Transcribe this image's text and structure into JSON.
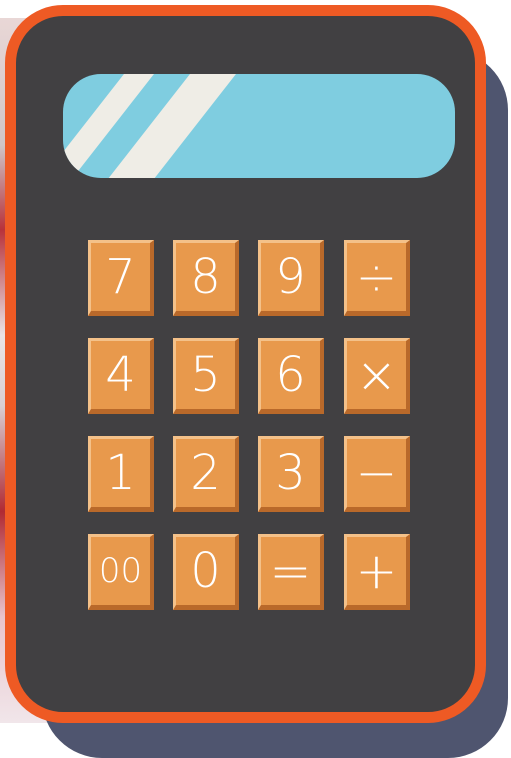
{
  "calculator": {
    "display": "",
    "rows": [
      [
        "7",
        "8",
        "9",
        "÷"
      ],
      [
        "4",
        "5",
        "6",
        "×"
      ],
      [
        "1",
        "2",
        "3",
        "−"
      ],
      [
        "00",
        "0",
        "=",
        "+"
      ]
    ],
    "colors": {
      "body": "#414042",
      "border": "#ee5a24",
      "display": "#7fcde0",
      "key": "#e8994c",
      "shadow": "#4f556f"
    }
  }
}
